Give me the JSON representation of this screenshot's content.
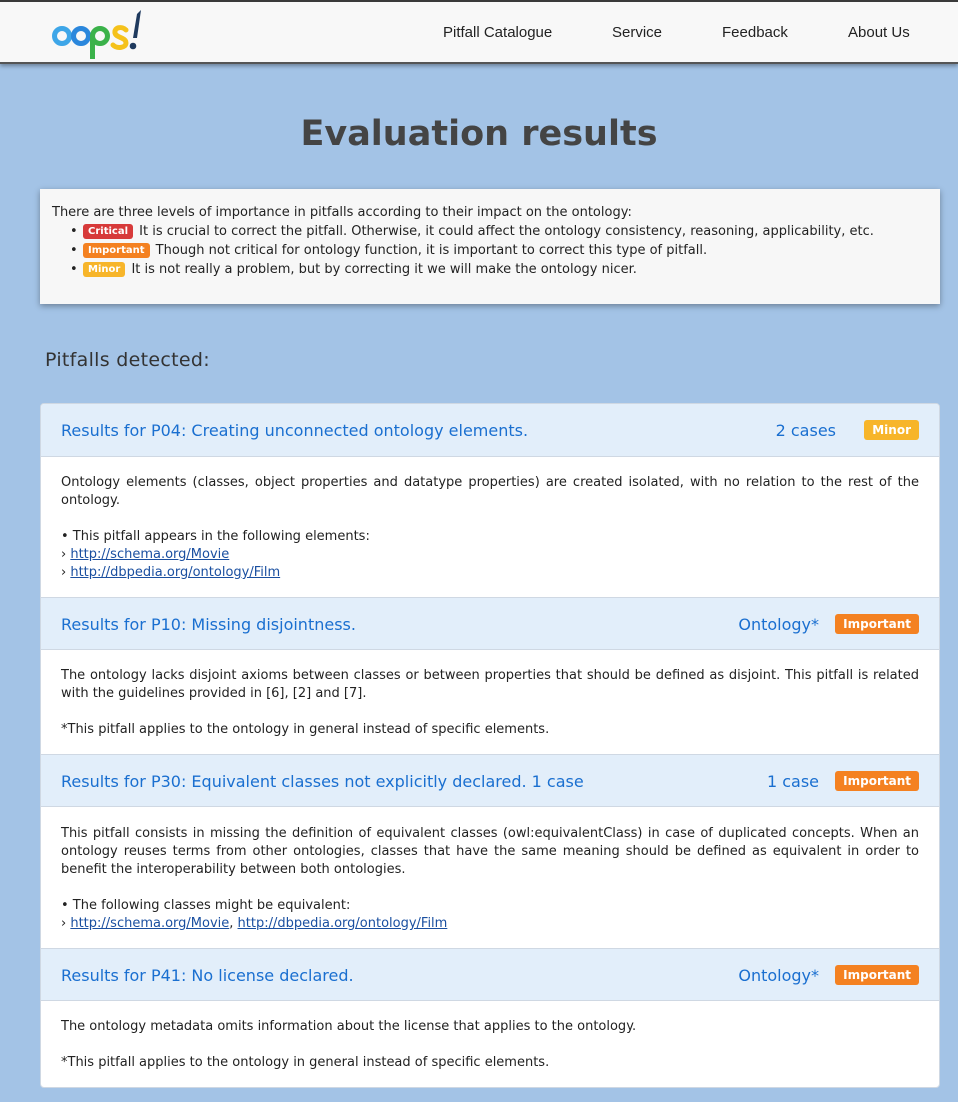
{
  "nav": {
    "logo_alt": "oops!",
    "items": [
      "Pitfall Catalogue",
      "Service",
      "Feedback",
      "About Us"
    ]
  },
  "page_title": "Evaluation results",
  "legend": {
    "intro": "There are three levels of importance in pitfalls according to their impact on the ontology:",
    "levels": [
      {
        "badge": "Critical",
        "text": "It is crucial to correct the pitfall. Otherwise, it could affect the ontology consistency, reasoning, applicability, etc."
      },
      {
        "badge": "Important",
        "text": "Though not critical for ontology function, it is important to correct this type of pitfall."
      },
      {
        "badge": "Minor",
        "text": "It is not really a problem, but by correcting it we will make the ontology nicer."
      }
    ]
  },
  "section_title": "Pitfalls detected:",
  "pitfalls": [
    {
      "title": "Results for P04: Creating unconnected ontology elements.",
      "cases": "2 cases",
      "badge": "Minor",
      "description": "Ontology elements (classes, object properties and datatype properties) are created isolated, with no relation to the rest of the ontology.",
      "elements_label": "• This pitfall appears in the following elements:",
      "links": [
        "http://schema.org/Movie",
        "http://dbpedia.org/ontology/Film"
      ]
    },
    {
      "title": "Results for P10: Missing disjointness.",
      "cases": "Ontology*",
      "badge": "Important",
      "description": "The ontology lacks disjoint axioms between classes or between properties that should be defined as disjoint. This pitfall is related with the guidelines provided in [6], [2] and [7].",
      "note": "*This pitfall applies to the ontology in general instead of specific elements."
    },
    {
      "title": "Results for P30: Equivalent classes not explicitly declared. 1 case",
      "cases": "1 case",
      "badge": "Important",
      "description": "This pitfall consists in missing the definition of equivalent classes (owl:equivalentClass) in case of duplicated concepts. When an ontology reuses terms from other ontologies, classes that have the same meaning should be defined as equivalent in order to benefit the interoperability between both ontologies.",
      "elements_label": "• The following classes might be equivalent:",
      "links": [
        "http://schema.org/Movie",
        "http://dbpedia.org/ontology/Film"
      ]
    },
    {
      "title": "Results for P41: No license declared.",
      "cases": "Ontology*",
      "badge": "Important",
      "description": "The ontology metadata omits information about the license that applies to the ontology.",
      "note": "*This pitfall applies to the ontology in general instead of specific elements."
    }
  ],
  "colors": {
    "background": "#a3c3e6",
    "critical": "#d73a3a",
    "important": "#f48121",
    "minor": "#f7b52a",
    "link": "#1a6fd0",
    "panel_header": "#e2eefa"
  }
}
